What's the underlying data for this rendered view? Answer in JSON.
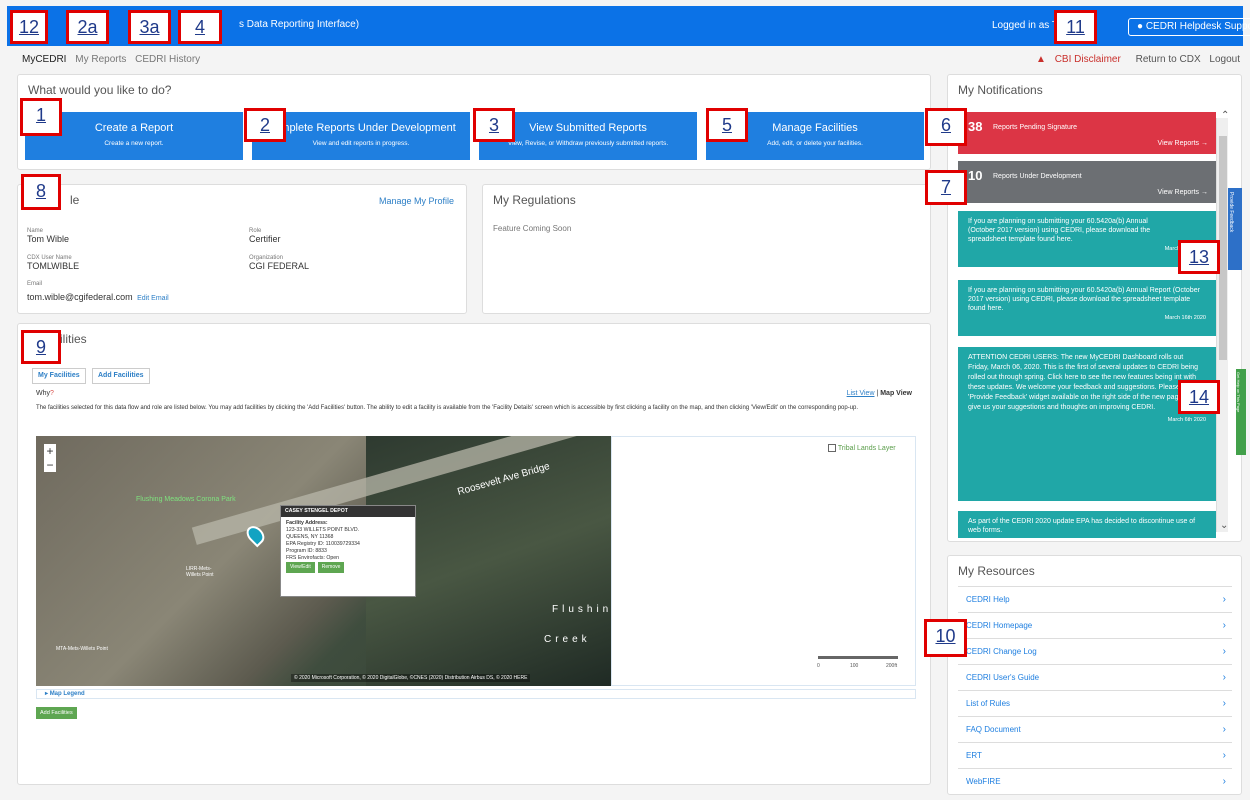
{
  "header": {
    "brand": "A  R",
    "subtitle": "s Data Reporting Interface)",
    "login_text": "Logged in as Tom",
    "helpdesk": "CEDRI Helpdesk Support"
  },
  "subnav": {
    "items": [
      "MyCEDRI",
      "My Reports",
      "CEDRI History"
    ]
  },
  "rightnav": {
    "cbi": "CBI Disclaimer",
    "return": "Return to CDX",
    "logout": "Logout"
  },
  "actions": {
    "title": "What would you like to do?",
    "buttons": [
      {
        "title": "Create a Report",
        "subtitle": "Create a new report."
      },
      {
        "title": "Complete Reports Under Development",
        "subtitle": "View and edit reports in progress."
      },
      {
        "title": "View Submitted Reports",
        "subtitle": "View, Revise, or Withdraw previously submitted reports."
      },
      {
        "title": "Manage Facilities",
        "subtitle": "Add, edit, or delete your facilities."
      }
    ]
  },
  "profile": {
    "title": "le",
    "manage": "Manage My Profile",
    "name_label": "Name",
    "name": "Tom Wible",
    "role_label": "Role",
    "role": "Certifier",
    "cdx_label": "CDX User Name",
    "cdx": "TOMLWIBLE",
    "org_label": "Organization",
    "org": "CGI FEDERAL",
    "email_label": "Email",
    "email": "tom.wible@cgifederal.com",
    "edit_email": "Edit Email"
  },
  "regulations": {
    "title": "My Regulations",
    "text": "Feature Coming Soon"
  },
  "facilities": {
    "title": "ilities",
    "tabs": [
      "My Facilities",
      "Add Facilities"
    ],
    "why": "Why",
    "list_view": "List View",
    "map_view": "Map View",
    "intro": "The facilities selected for this data flow and role are listed below. You may add facilities by clicking the 'Add Facilities' button. The ability to edit a facility is available from the 'Facility Details' screen which is accessible by first clicking a facility on the map, and then clicking 'View/Edit' on the corresponding pop-up.",
    "tribal_layer": "Tribal Lands Layer",
    "map_legend": "Map Legend",
    "add_button": "Add Facilities",
    "popup": {
      "name": "CASEY STENGEL DEPOT",
      "address_label": "Facility Address:",
      "address1": "123-33 WILLETS POINT BLVD.",
      "address2": "QUEENS, NY 11368",
      "registry": "EPA Registry ID: 110039729334",
      "program": "Program ID: 8833",
      "frs": "FRS Envirofacts: Open",
      "view": "View/Edit",
      "remove": "Remove"
    },
    "map_labels": [
      "Roosevelt Ave Bridge",
      "Flushing Meadows Corona Park",
      "Flushing",
      "Creek",
      "LIRR-Mets-Willets Point",
      "MTA-Mets-Willets Point"
    ],
    "scale": [
      "0",
      "100",
      "200ft"
    ],
    "copyright": "© 2020 Microsoft Corporation, © 2020 DigitalGlobe, ©CNES (2020) Distribution Airbus DS, © 2020 HERE"
  },
  "notifications": {
    "title": "My Notifications",
    "pending_count": "38",
    "pending_text": "Reports Pending Signature",
    "pending_link": "View Reports →",
    "dev_count": "10",
    "dev_text": "Reports Under Development",
    "dev_link": "View Reports →",
    "notes": [
      {
        "text": "If you are planning on submitting your 60.5420a(b) Annual (October 2017 version) using CEDRI, please download the spreadsheet template found here.",
        "date": "March 16th 2020"
      },
      {
        "text": "If you are planning on submitting your 60.5420a(b) Annual Report (October 2017 version) using CEDRI, please download the spreadsheet template found here.",
        "date": "March 16th 2020"
      },
      {
        "text": "ATTENTION CEDRI USERS: The new MyCEDRI Dashboard rolls out Friday, March 06, 2020. This is the first of several updates to CEDRI being rolled out through spring. Click here to see the new features being int with these updates. We welcome your feedback and suggestions. Please use the 'Provide Feedback' widget available on the right side of the new pages to give us your suggestions and thoughts on improving CEDRI.",
        "date": "March 6th 2020"
      },
      {
        "text": "As part of the CEDRI 2020 update EPA has decided to discontinue use of web forms.",
        "date": ""
      }
    ]
  },
  "resources": {
    "title": "My Resources",
    "items": [
      "CEDRI Help",
      "CEDRI Homepage",
      "CEDRI Change Log",
      "CEDRI User's Guide",
      "List of Rules",
      "FAQ Document",
      "ERT",
      "WebFIRE"
    ]
  },
  "side_tabs": {
    "feedback": "Provide Feedback",
    "help": "Get Help on This Page"
  },
  "markers": [
    "12",
    "2a",
    "3a",
    "4",
    "11",
    "1",
    "2",
    "3",
    "5",
    "6",
    "7",
    "8",
    "9",
    "10",
    "13",
    "14"
  ]
}
